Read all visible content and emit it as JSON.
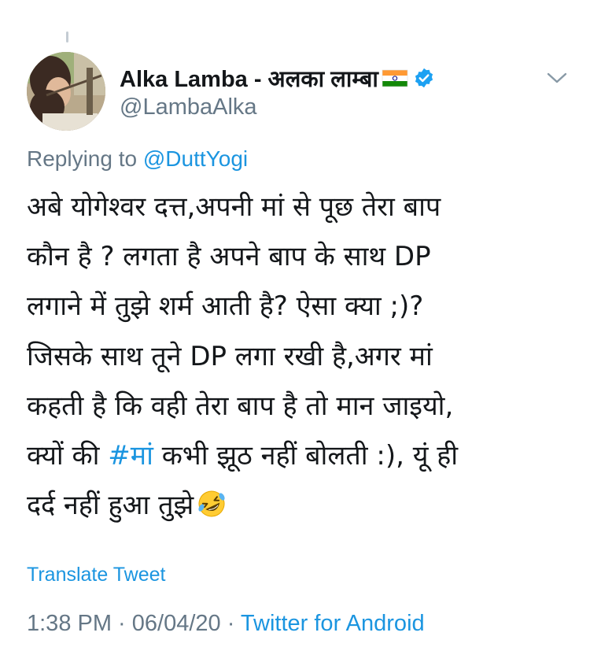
{
  "author": {
    "display_name": "Alka Lamba - अलका लाम्बा",
    "handle": "@LambaAlka",
    "flag_icon": "india-flag-icon",
    "verified_icon": "verified-badge-icon"
  },
  "reply": {
    "prefix": "Replying to ",
    "mention": "@DuttYogi"
  },
  "body": {
    "line1": "अबे योगेश्वर दत्त,अपनी मां से पूछ तेरा बाप",
    "line2": "कौन है ? लगता है अपने बाप के साथ DP",
    "line3": "लगाने में तुझे शर्म आती है? ऐसा क्या ;)?",
    "line4": "जिसके साथ तूने DP लगा रखी है,अगर मां",
    "line5": "कहती है कि वही तेरा बाप है तो मान जाइयो,",
    "line6_pre": "क्यों की ",
    "line6_hashtag": "#मां",
    "line6_post": " कभी झूठ नहीं बोलती :), यूं ही",
    "line7": "दर्द नहीं हुआ तुझे",
    "emoji_icon": "rolling-on-floor-laughing-emoji-icon"
  },
  "translate_label": "Translate Tweet",
  "meta": {
    "time": "1:38 PM",
    "sep1": " · ",
    "date": "06/04/20",
    "sep2": " · ",
    "source": "Twitter for Android"
  },
  "colors": {
    "link": "#1b95e0",
    "secondary_text": "#657786",
    "primary_text": "#14171a",
    "verified": "#1da1f2"
  }
}
